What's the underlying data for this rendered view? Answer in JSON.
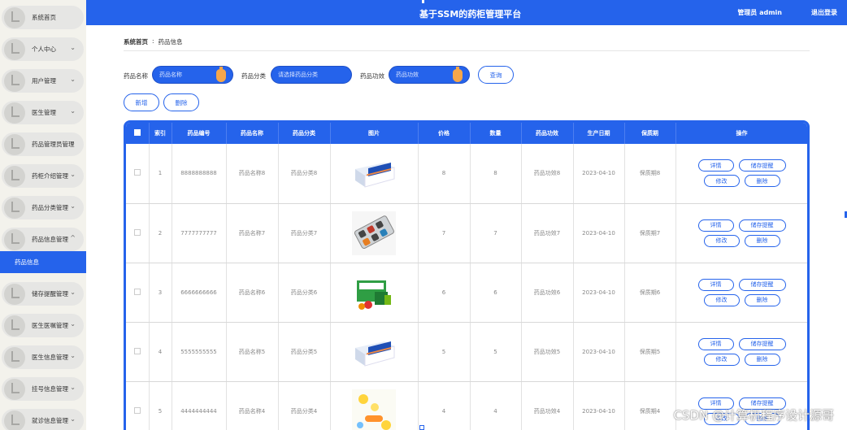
{
  "header": {
    "title": "基于SSM的药柜管理平台",
    "user": "管理员 admin",
    "logout": "退出登录"
  },
  "sidebar": {
    "items": [
      {
        "label": "系统首页",
        "chevron": false
      },
      {
        "label": "个人中心",
        "chevron": true
      },
      {
        "label": "用户管理",
        "chevron": true
      },
      {
        "label": "医生管理",
        "chevron": true
      },
      {
        "label": "药品管理员管理",
        "chevron": true
      },
      {
        "label": "药柜介绍管理",
        "chevron": true
      },
      {
        "label": "药品分类管理",
        "chevron": true
      },
      {
        "label": "药品信息管理",
        "chevron": true,
        "expanded": true
      },
      {
        "label": "储存提醒管理",
        "chevron": true
      },
      {
        "label": "医生医嘱管理",
        "chevron": true
      },
      {
        "label": "医生信息管理",
        "chevron": true
      },
      {
        "label": "挂号信息管理",
        "chevron": true
      },
      {
        "label": "就诊信息管理",
        "chevron": true
      }
    ],
    "active_sub": "药品信息"
  },
  "breadcrumb": {
    "home": "系统首页",
    "separator": ":",
    "current": "药品信息"
  },
  "search": {
    "name_label": "药品名称",
    "name_placeholder": "药品名称",
    "category_label": "药品分类",
    "category_placeholder": "请选择药品分类",
    "effect_label": "药品功效",
    "effect_placeholder": "药品功效",
    "query_button": "查询"
  },
  "actions": {
    "add": "新增",
    "delete": "删除"
  },
  "table": {
    "columns": [
      "索引",
      "药品编号",
      "药品名称",
      "药品分类",
      "图片",
      "价格",
      "数量",
      "药品功效",
      "生产日期",
      "保质期",
      "操作"
    ],
    "rows": [
      {
        "index": "1",
        "code": "8888888888",
        "name": "药品名称8",
        "category": "药品分类8",
        "image": "blue-box",
        "price": "8",
        "qty": "8",
        "effect": "药品功效8",
        "date": "2023-04-10",
        "shelf": "保质期8"
      },
      {
        "index": "2",
        "code": "7777777777",
        "name": "药品名称7",
        "category": "药品分类7",
        "image": "blister-pack",
        "price": "7",
        "qty": "7",
        "effect": "药品功效7",
        "date": "2023-04-10",
        "shelf": "保质期7"
      },
      {
        "index": "3",
        "code": "6666666666",
        "name": "药品名称6",
        "category": "药品分类6",
        "image": "green-box",
        "price": "6",
        "qty": "6",
        "effect": "药品功效6",
        "date": "2023-04-10",
        "shelf": "保质期6"
      },
      {
        "index": "4",
        "code": "5555555555",
        "name": "药品名称5",
        "category": "药品分类5",
        "image": "blue-box",
        "price": "5",
        "qty": "5",
        "effect": "药品功效5",
        "date": "2023-04-10",
        "shelf": "保质期5"
      },
      {
        "index": "5",
        "code": "4444444444",
        "name": "药品名称4",
        "category": "药品分类4",
        "image": "yellow-pills",
        "price": "4",
        "qty": "4",
        "effect": "药品功效4",
        "date": "2023-04-10",
        "shelf": "保质期4"
      }
    ],
    "op_labels": {
      "detail": "详情",
      "remind": "储存提醒",
      "edit": "修改",
      "delete": "删除"
    }
  },
  "watermark": "CSDN @计算机程序设计源哥",
  "colors": {
    "primary": "#2563eb",
    "accent": "#f5a64a",
    "sidebar_bg": "#f3f2ec"
  }
}
